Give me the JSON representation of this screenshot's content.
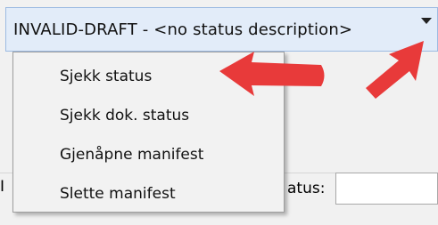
{
  "status_select": {
    "value": "INVALID-DRAFT - <no status description>"
  },
  "menu": {
    "items": [
      {
        "label": "Sjekk status"
      },
      {
        "label": "Sjekk dok. status"
      },
      {
        "label": "Gjenåpne manifest"
      },
      {
        "label": "Slette manifest"
      }
    ]
  },
  "background": {
    "left_label": "I",
    "status_label": "atus:"
  },
  "annotations": {
    "arrow_color": "#e83a3a",
    "arrow_icons": [
      "arrow-pointing-left-icon",
      "arrow-pointing-up-right-icon"
    ]
  }
}
